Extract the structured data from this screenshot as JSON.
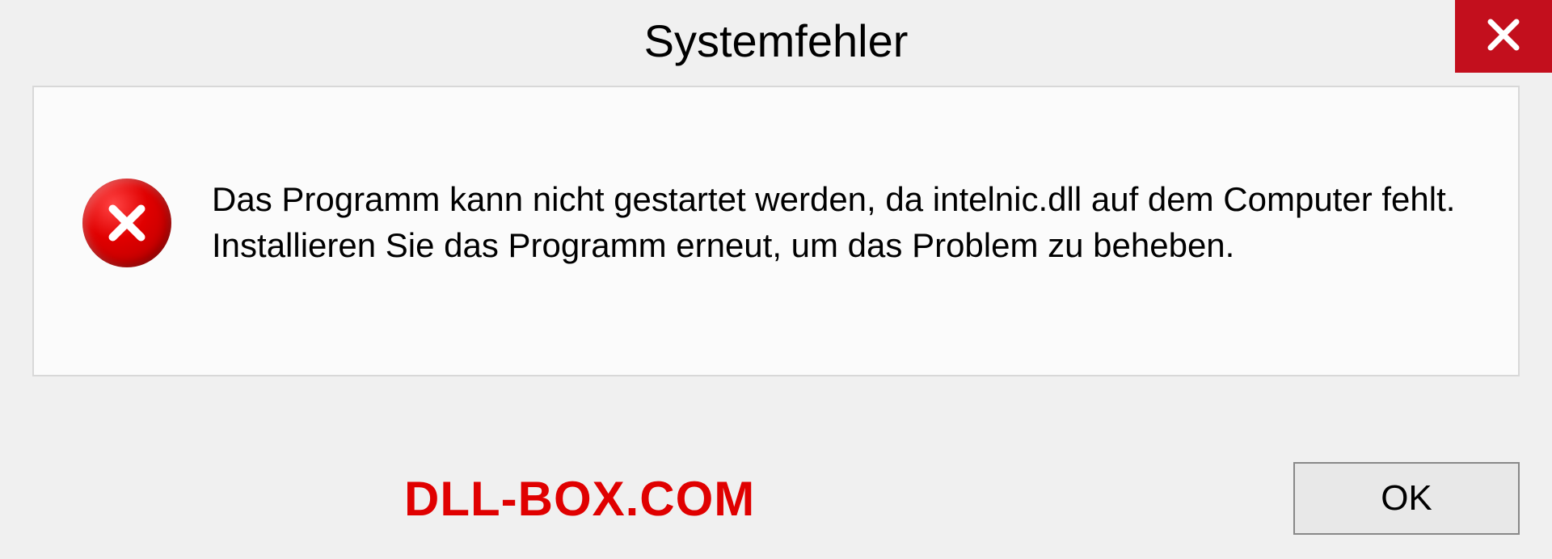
{
  "dialog": {
    "title": "Systemfehler",
    "message": "Das Programm kann nicht gestartet werden, da intelnic.dll auf dem Computer fehlt. Installieren Sie das Programm erneut, um das Problem zu beheben.",
    "ok_label": "OK"
  },
  "watermark": {
    "text": "DLL-BOX.COM"
  }
}
